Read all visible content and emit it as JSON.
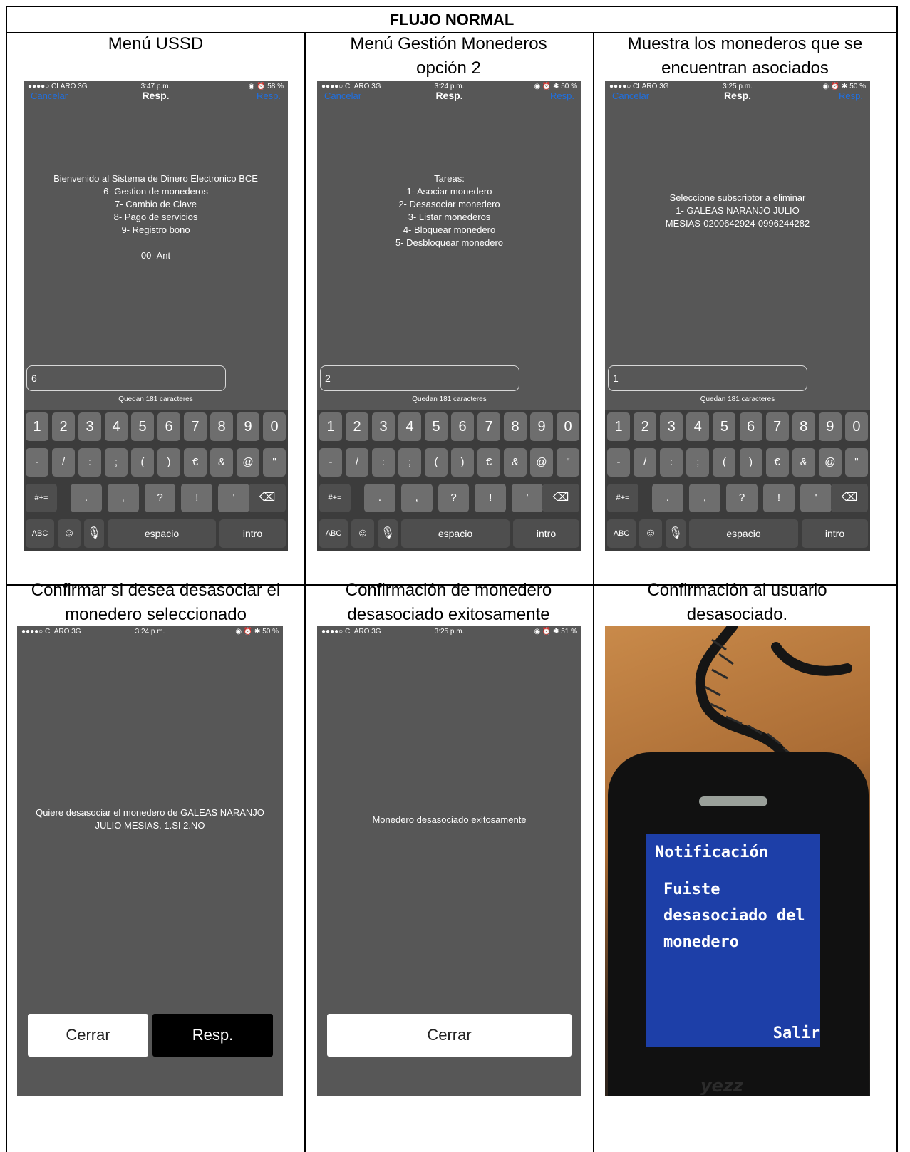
{
  "title": "FLUJO NORMAL",
  "captions": [
    [
      "Menú USSD"
    ],
    [
      "Menú Gestión Monederos",
      "opción 2"
    ],
    [
      "Muestra los monederos que se",
      "encuentran asociados"
    ],
    [
      "Confirmar si desea desasociar el",
      "monedero seleccionado"
    ],
    [
      "Confirmación de monedero",
      "desasociado exitosamente"
    ],
    [
      "Confirmación al usuario",
      "desasociado."
    ]
  ],
  "screens": [
    {
      "carrier": "●●●●○ CLARO  3G",
      "time": "3:47 p.m.",
      "battery": "◉ ⏰ 58 %",
      "nav_left": "Cancelar",
      "nav_title": "Resp.",
      "nav_right": "Resp.",
      "lines": [
        "Bienvenido al  Sistema de Dinero Electronico BCE",
        "6- Gestion de monederos",
        "7- Cambio de Clave",
        "8- Pago de servicios",
        "9- Registro bono",
        "",
        "00- Ant"
      ],
      "input": "6",
      "counter": "Quedan 181 caracteres"
    },
    {
      "carrier": "●●●●○ CLARO  3G",
      "time": "3:24 p.m.",
      "battery": "◉ ⏰ ✱ 50 %",
      "nav_left": "Cancelar",
      "nav_title": "Resp.",
      "nav_right": "Resp.",
      "lines": [
        "Tareas:",
        "1- Asociar monedero",
        "2- Desasociar monedero",
        "3- Listar monederos",
        "4- Bloquear monedero",
        "5- Desbloquear monedero"
      ],
      "input": "2",
      "counter": "Quedan 181 caracteres"
    },
    {
      "carrier": "●●●●○ CLARO  3G",
      "time": "3:25 p.m.",
      "battery": "◉ ⏰ ✱ 50 %",
      "nav_left": "Cancelar",
      "nav_title": "Resp.",
      "nav_right": "Resp.",
      "lines": [
        "Seleccione subscriptor a eliminar",
        "1- GALEAS NARANJO JULIO",
        "MESIAS-0200642924-0996244282"
      ],
      "input": "1",
      "counter": "Quedan 181 caracteres"
    },
    {
      "carrier": "●●●●○ CLARO  3G",
      "time": "3:24 p.m.",
      "battery": "◉ ⏰ ✱ 50 %",
      "lines": [
        "Quiere desasociar el monedero de GALEAS NARANJO",
        "JULIO MESIAS.  1.SI  2.NO"
      ],
      "buttons": [
        "Cerrar",
        "Resp."
      ]
    },
    {
      "carrier": "●●●●○ CLARO  3G",
      "time": "3:25 p.m.",
      "battery": "◉ ⏰ ✱ 51 %",
      "lines": [
        "Monedero desasociado exitosamente"
      ],
      "buttons": [
        "Cerrar"
      ]
    }
  ],
  "keyboard": {
    "row1": [
      "1",
      "2",
      "3",
      "4",
      "5",
      "6",
      "7",
      "8",
      "9",
      "0"
    ],
    "row2": [
      "-",
      "/",
      ":",
      ";",
      "(",
      ")",
      "€",
      "&",
      "@",
      "\""
    ],
    "row3": [
      "#+=",
      ".",
      ",",
      "?",
      "!",
      "'",
      "⌫"
    ],
    "row4": [
      "ABC",
      "☺",
      "🎙",
      "espacio",
      "intro"
    ]
  },
  "feature_phone": {
    "heading": "Notificación",
    "message": [
      "Fuiste",
      "desasociado del",
      "monedero"
    ],
    "softkey": "Salir",
    "brand": "yezz"
  },
  "colors": {
    "screen_bg": "#575757",
    "keyboard_bg": "#3c3c3c",
    "key_bg": "#6e6e6e",
    "link_blue": "#1f6fe0",
    "phone_screen_blue": "#1d3fa8"
  }
}
